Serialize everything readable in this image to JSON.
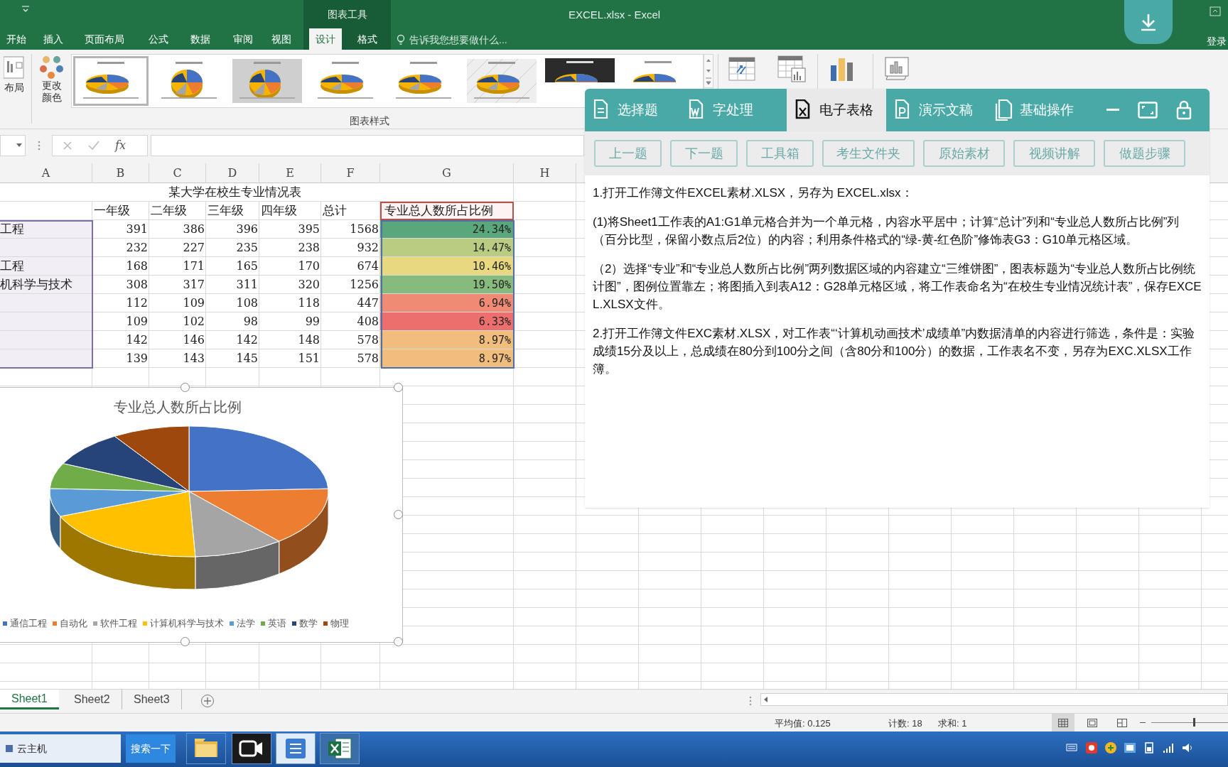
{
  "title_bar": {
    "context_tab": "图表工具",
    "title": "EXCEL.xlsx - Excel",
    "sign_in": "登录"
  },
  "ribbon_tabs": [
    {
      "label": "开始",
      "selected": false
    },
    {
      "label": "插入",
      "selected": false
    },
    {
      "label": "页面布局",
      "selected": false
    },
    {
      "label": "公式",
      "selected": false
    },
    {
      "label": "数据",
      "selected": false
    },
    {
      "label": "审阅",
      "selected": false
    },
    {
      "label": "视图",
      "selected": false
    },
    {
      "label": "设计",
      "selected": true
    },
    {
      "label": "格式",
      "selected": false
    }
  ],
  "tell_me": {
    "placeholder": "告诉我您想要做什么..."
  },
  "ribbon": {
    "layout_button": "布局",
    "color_button": "更改颜色",
    "gallery_label": "图表样式",
    "thumbnails": [
      {
        "selected": true
      },
      {
        "selected": false
      },
      {
        "selected": false
      },
      {
        "selected": false
      },
      {
        "selected": false
      },
      {
        "selected": false
      },
      {
        "selected": false
      },
      {
        "selected": false
      }
    ]
  },
  "formula_bar": {
    "fx": "fx"
  },
  "sheet": {
    "columns": [
      "A",
      "B",
      "C",
      "D",
      "E",
      "F",
      "G",
      "H"
    ],
    "title": "某大学在校生专业情况表",
    "headers": [
      "一年级",
      "二年级",
      "三年级",
      "四年级",
      "总计",
      "专业总人数所占比例"
    ],
    "rows": [
      {
        "name": "工程",
        "values": [
          "391",
          "386",
          "396",
          "395",
          "1568"
        ],
        "ratio": "24.34%",
        "color": "#5aa77c"
      },
      {
        "values": [
          "232",
          "227",
          "235",
          "238",
          "932"
        ],
        "ratio": "14.47%",
        "color": "#b9cc82"
      },
      {
        "name": "工程",
        "values": [
          "168",
          "171",
          "165",
          "170",
          "674"
        ],
        "ratio": "10.46%",
        "color": "#e8d87f"
      },
      {
        "name": "机科学与技术",
        "values": [
          "308",
          "317",
          "311",
          "320",
          "1256"
        ],
        "ratio": "19.50%",
        "color": "#87bb7e"
      },
      {
        "values": [
          "112",
          "109",
          "108",
          "118",
          "447"
        ],
        "ratio": "6.94%",
        "color": "#ef8a75"
      },
      {
        "values": [
          "109",
          "102",
          "98",
          "99",
          "408"
        ],
        "ratio": "6.33%",
        "color": "#ec6f6e"
      },
      {
        "values": [
          "142",
          "146",
          "142",
          "148",
          "578"
        ],
        "ratio": "8.97%",
        "color": "#f0bd7d"
      },
      {
        "values": [
          "139",
          "143",
          "145",
          "151",
          "578"
        ],
        "ratio": "8.97%",
        "color": "#f0bd7d"
      }
    ]
  },
  "chart": {
    "title": "专业总人数所占比例",
    "legend": [
      {
        "label": "通信工程",
        "color": "#4472c4"
      },
      {
        "label": "自动化",
        "color": "#ed7d31"
      },
      {
        "label": "软件工程",
        "color": "#a5a5a5"
      },
      {
        "label": "计算机科学与技术",
        "color": "#ffc000"
      },
      {
        "label": "法学",
        "color": "#5b9bd5"
      },
      {
        "label": "英语",
        "color": "#70ad47"
      },
      {
        "label": "数学",
        "color": "#264478"
      },
      {
        "label": "物理",
        "color": "#9e480e"
      }
    ]
  },
  "panel": {
    "tabs": [
      {
        "label": "选择题",
        "selected": false
      },
      {
        "label": "字处理",
        "selected": false
      },
      {
        "label": "电子表格",
        "selected": true
      },
      {
        "label": "演示文稿",
        "selected": false
      },
      {
        "label": "基础操作",
        "selected": false
      }
    ],
    "buttons": [
      "上一题",
      "下一题",
      "工具箱",
      "考生文件夹",
      "原始素材",
      "视频讲解",
      "做题步骤"
    ],
    "paragraphs": [
      "1.打开工作簿文件EXCEL素材.XLSX，另存为 EXCEL.xlsx：",
      "(1)将Sheet1工作表的A1:G1单元格合并为一个单元格，内容水平居中；计算“总计”列和“专业总人数所占比例”列（百分比型，保留小数点后2位）的内容；利用条件格式的“绿-黄-红色阶”修饰表G3：G10单元格区域。",
      "（2）选择“专业”和“专业总人数所占比例”两列数据区域的内容建立“三维饼图”，图表标题为“专业总人数所占比例统计图”，图例位置靠左；将图插入到表A12：G28单元格区域，将工作表命名为“在校生专业情况统计表”，保存EXCEL.XLSX文件。",
      "2.打开工作簿文件EXC素材.XLSX，对工作表“‘计算机动画技术’成绩单”内数据清单的内容进行筛选，条件是：实验成绩15分及以上，总成绩在80分到100分之间（含80分和100分）的数据，工作表名不变，另存为EXC.XLSX工作簿。"
    ]
  },
  "sheet_tabs": [
    {
      "label": "Sheet1",
      "selected": true
    },
    {
      "label": "Sheet2",
      "selected": false
    },
    {
      "label": "Sheet3",
      "selected": false
    }
  ],
  "status_bar": {
    "average": "平均值: 0.125",
    "count": "计数: 18",
    "sum": "求和: 1",
    "zoom_slider": {
      "level": 0.55
    }
  },
  "taskbar": {
    "start_label": "云主机",
    "search_button": "搜索一下"
  }
}
